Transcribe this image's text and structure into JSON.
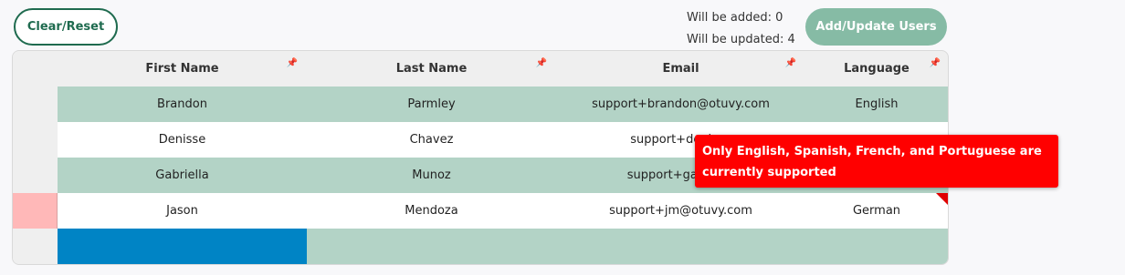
{
  "toolbar": {
    "clear_label": "Clear/Reset",
    "added_text": "Will be added: 0",
    "updated_text": "Will be updated: 4",
    "add_label": "Add/Update Users"
  },
  "columns": [
    "First Name",
    "Last Name",
    "Email",
    "Language"
  ],
  "rows": [
    {
      "first": "Brandon",
      "last": "Parmley",
      "email": "support+brandon@otuvy.com",
      "lang": "English"
    },
    {
      "first": "Denisse",
      "last": "Chavez",
      "email": "support+denisse",
      "lang": ""
    },
    {
      "first": "Gabriella",
      "last": "Munoz",
      "email": "support+gabriella",
      "lang": ""
    },
    {
      "first": "Jason",
      "last": "Mendoza",
      "email": "support+jm@otuvy.com",
      "lang": "German"
    }
  ],
  "tooltip": {
    "text": "Only English, Spanish, French, and Portuguese are currently supported"
  },
  "colors": {
    "accent_green": "#1f6b4f",
    "row_green": "#b3d3c6",
    "error_red": "#ff0000",
    "selection_blue": "#0084c5"
  }
}
